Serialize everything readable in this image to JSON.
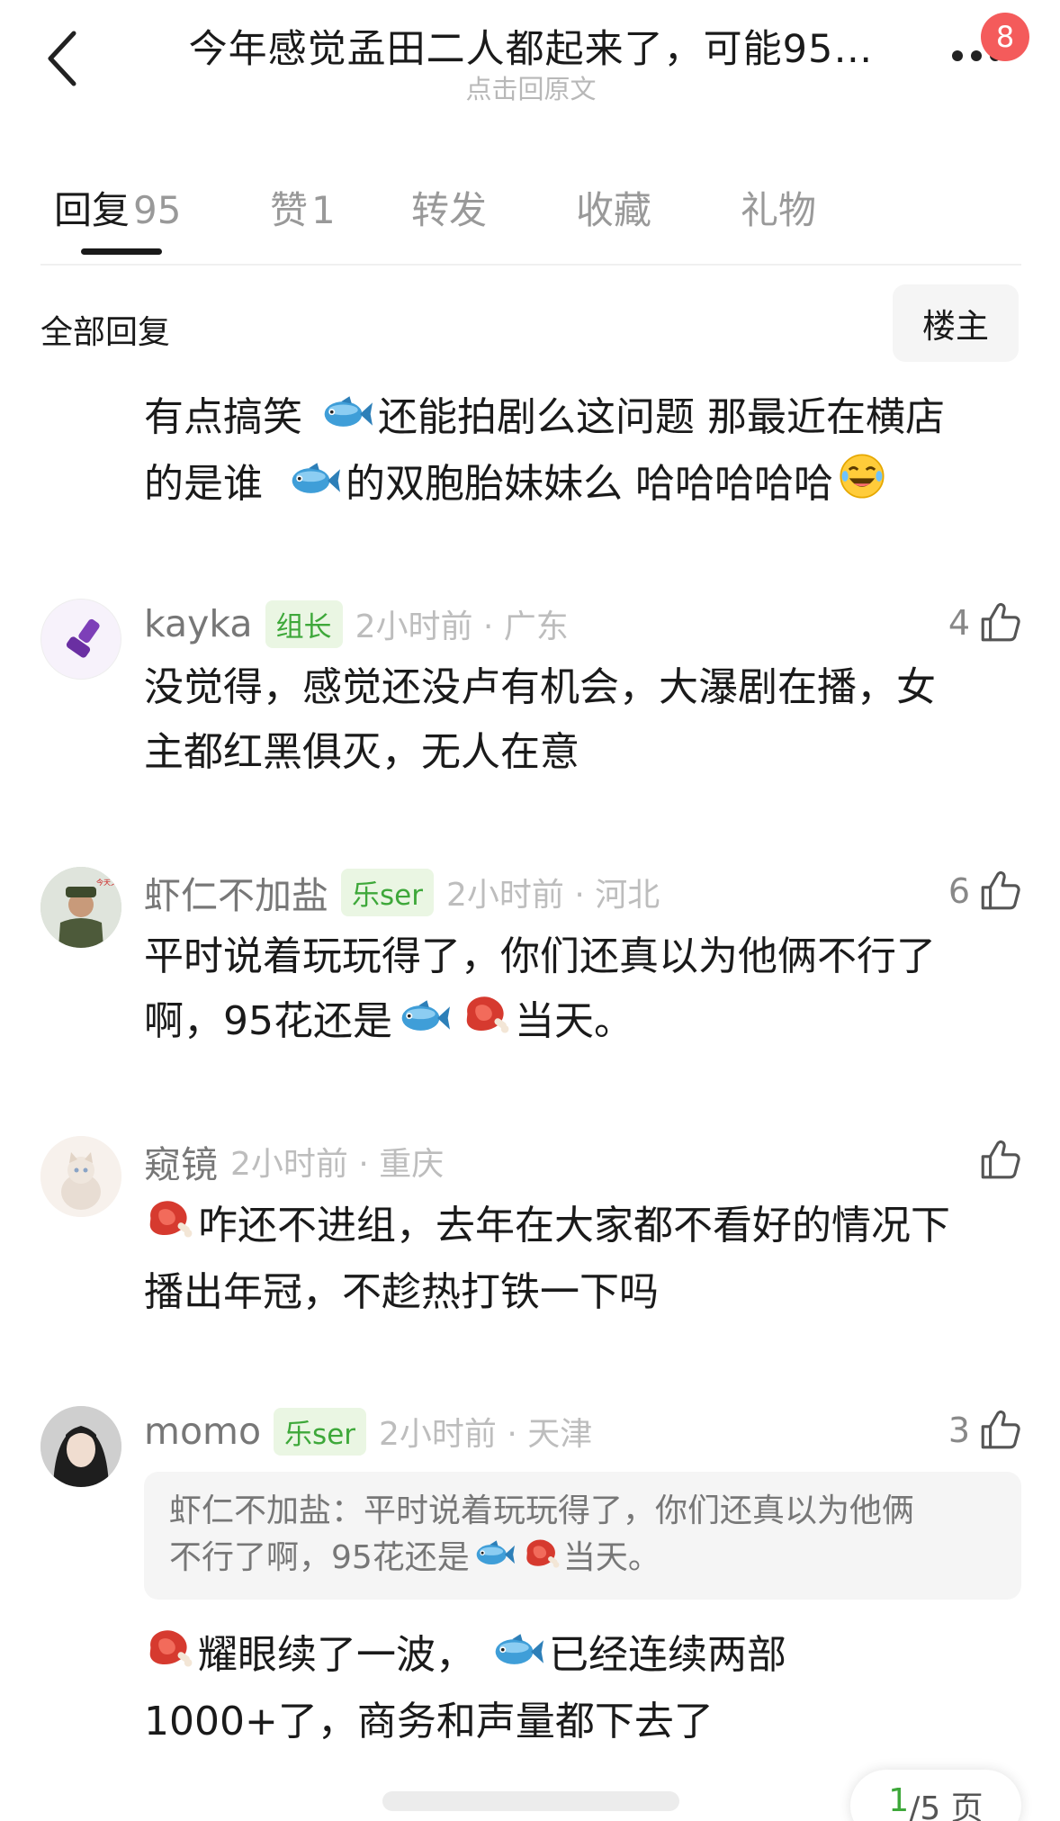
{
  "header": {
    "title": "今年感觉孟田二人都起来了，可能95…",
    "subtitle": "点击回原文",
    "notification_count": "8"
  },
  "tabs": [
    {
      "label": "回复",
      "count": "95",
      "active": true
    },
    {
      "label": "赞",
      "count": "1",
      "active": false
    },
    {
      "label": "转发",
      "count": "",
      "active": false
    },
    {
      "label": "收藏",
      "count": "",
      "active": false
    },
    {
      "label": "礼物",
      "count": "",
      "active": false
    }
  ],
  "filter": {
    "label": "全部回复",
    "op_button": "楼主"
  },
  "top_comment": {
    "line1_a": "有点搞笑",
    "line1_b": "还能拍剧么这问题  那最近在横店",
    "line2_a": "的是谁",
    "line2_b": "的双胞胎妹妹么 哈哈哈哈哈"
  },
  "comments": [
    {
      "username": "kayka",
      "badge": "组长",
      "time": "2小时前 · 广东",
      "likes": "4",
      "line1": "没觉得，感觉还没卢有机会，大瀑剧在播，女",
      "line2": "主都红黑俱灭，无人在意"
    },
    {
      "username": "虾仁不加盐",
      "badge": "乐ser",
      "time": "2小时前 · 河北",
      "likes": "6",
      "line1": "平时说着玩玩得了，你们还真以为他俩不行了",
      "line2_a": "啊，95花还是",
      "line2_b": "当天。"
    },
    {
      "username": "窥镜",
      "badge": "",
      "time": "2小时前 · 重庆",
      "likes": "",
      "line1": "咋还不进组，去年在大家都不看好的情况下",
      "line2": "播出年冠，不趁热打铁一下吗"
    },
    {
      "username": "momo",
      "badge": "乐ser",
      "time": "2小时前 · 天津",
      "likes": "3",
      "quote_line1": "虾仁不加盐：平时说着玩玩得了，你们还真以为他俩",
      "quote_line2_a": "不行了啊，95花还是",
      "quote_line2_b": "当天。",
      "line1_a": "耀眼续了一波，",
      "line1_b": "已经连续两部",
      "line2": "1000+了，商务和声量都下去了"
    }
  ],
  "pager": {
    "current": "1",
    "rest": "/5 页"
  },
  "icons": [
    "back-arrow-icon",
    "more-dots-icon",
    "fish-emoji-icon",
    "steak-emoji-icon",
    "laugh-emoji-icon",
    "thumbs-up-icon"
  ]
}
